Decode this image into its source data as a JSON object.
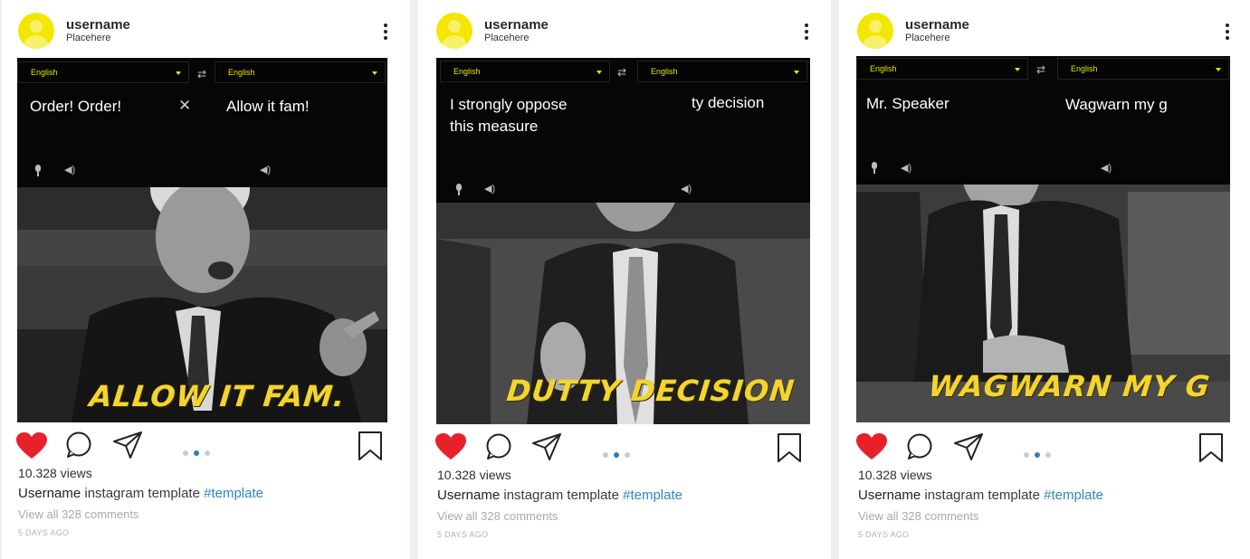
{
  "posts": [
    {
      "username": "username",
      "location": "Placehere",
      "translator": {
        "source_lang": "English",
        "target_lang": "English",
        "source_text": "Order! Order!",
        "target_text": "Allow it fam!"
      },
      "caption_overlay": "ALLOW IT FAM.",
      "views": "10.328 views",
      "caption": {
        "user": "Username",
        "text": "instagram template",
        "tag": "#template"
      },
      "comments": "View all 328 comments",
      "time": "5 DAYS AGO",
      "carousel": {
        "count": 3,
        "active": 2
      },
      "liked": true
    },
    {
      "username": "username",
      "location": "Placehere",
      "translator": {
        "source_lang": "English",
        "target_lang": "English",
        "source_text_line1": "I strongly oppose",
        "source_text_line2": "this measure",
        "target_text": "ty decision"
      },
      "caption_overlay": "DUTTY DECISION",
      "views": "10.328 views",
      "caption": {
        "user": "Username",
        "text": "instagram template",
        "tag": "#template"
      },
      "comments": "View all 328 comments",
      "time": "5 DAYS AGO",
      "carousel": {
        "count": 3,
        "active": 2
      },
      "liked": true
    },
    {
      "username": "username",
      "location": "Placehere",
      "translator": {
        "source_lang": "English",
        "target_lang": "English",
        "source_text": "Mr. Speaker",
        "target_text": "Wagwarn my g"
      },
      "caption_overlay": "WAGWARN MY G",
      "views": "10.328 views",
      "caption": {
        "user": "Username",
        "text": "instagram template",
        "tag": "#template"
      },
      "comments": "View all 328 comments",
      "time": "5 DAYS AGO",
      "carousel": {
        "count": 3,
        "active": 2
      },
      "liked": true
    }
  ],
  "colors": {
    "avatar": "#f3e600",
    "like_red": "#e8202a",
    "hashtag_blue": "#2f86c2",
    "meme_yellow": "#f4d42e",
    "lang_yellow": "#e6e600",
    "carousel_active": "#2d7fb6"
  },
  "icons": [
    "more-icon",
    "swap-icon",
    "close-icon",
    "mic-icon",
    "speaker-icon",
    "heart-icon",
    "comment-icon",
    "share-icon",
    "bookmark-icon"
  ]
}
